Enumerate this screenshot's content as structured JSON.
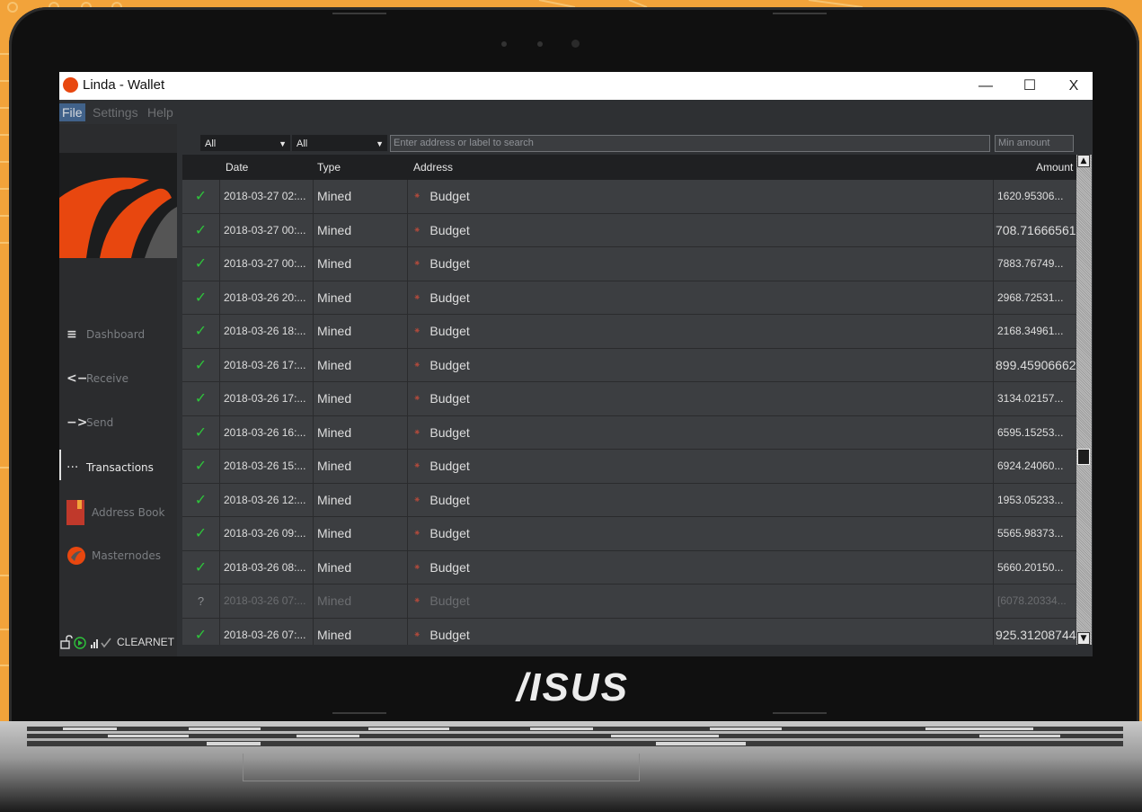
{
  "window": {
    "title": "Linda - Wallet",
    "minimize": "—",
    "maximize": "☐",
    "close": "X"
  },
  "menu": [
    "File",
    "Settings",
    "Help"
  ],
  "sidebar": {
    "items": [
      {
        "label": "Dashboard",
        "icon": "≡"
      },
      {
        "label": "Receive",
        "icon": "<−"
      },
      {
        "label": "Send",
        "icon": "−>"
      },
      {
        "label": "Transactions",
        "icon": "···"
      },
      {
        "label": "Address Book",
        "icon": "book-icon"
      },
      {
        "label": "Masternodes",
        "icon": "masternode-icon"
      }
    ],
    "status": {
      "network": "CLEARNET"
    }
  },
  "filters": {
    "date_filter": "All",
    "type_filter": "All",
    "search_placeholder": "Enter address or label to search",
    "min_amount_placeholder": "Min amount"
  },
  "table": {
    "columns": [
      "Date",
      "Type",
      "Address",
      "Amount"
    ],
    "rows": [
      {
        "status": "✓",
        "date": "2018-03-27 02:...",
        "type": "Mined",
        "address": "Budget",
        "amount": "1620.95306..."
      },
      {
        "status": "✓",
        "date": "2018-03-27 00:...",
        "type": "Mined",
        "address": "Budget",
        "amount": "708.71666561"
      },
      {
        "status": "✓",
        "date": "2018-03-27 00:...",
        "type": "Mined",
        "address": "Budget",
        "amount": "7883.76749..."
      },
      {
        "status": "✓",
        "date": "2018-03-26 20:...",
        "type": "Mined",
        "address": "Budget",
        "amount": "2968.72531..."
      },
      {
        "status": "✓",
        "date": "2018-03-26 18:...",
        "type": "Mined",
        "address": "Budget",
        "amount": "2168.34961..."
      },
      {
        "status": "✓",
        "date": "2018-03-26 17:...",
        "type": "Mined",
        "address": "Budget",
        "amount": "899.45906662"
      },
      {
        "status": "✓",
        "date": "2018-03-26 17:...",
        "type": "Mined",
        "address": "Budget",
        "amount": "3134.02157..."
      },
      {
        "status": "✓",
        "date": "2018-03-26 16:...",
        "type": "Mined",
        "address": "Budget",
        "amount": "6595.15253..."
      },
      {
        "status": "✓",
        "date": "2018-03-26 15:...",
        "type": "Mined",
        "address": "Budget",
        "amount": "6924.24060..."
      },
      {
        "status": "✓",
        "date": "2018-03-26 12:...",
        "type": "Mined",
        "address": "Budget",
        "amount": "1953.05233..."
      },
      {
        "status": "✓",
        "date": "2018-03-26 09:...",
        "type": "Mined",
        "address": "Budget",
        "amount": "5565.98373..."
      },
      {
        "status": "✓",
        "date": "2018-03-26 08:...",
        "type": "Mined",
        "address": "Budget",
        "amount": "5660.20150..."
      },
      {
        "status": "?",
        "date": "2018-03-26 07:...",
        "type": "Mined",
        "address": "Budget",
        "amount": "[6078.20334..."
      },
      {
        "status": "✓",
        "date": "2018-03-26 07:...",
        "type": "Mined",
        "address": "Budget",
        "amount": "925.31208744"
      }
    ]
  },
  "brand": {
    "laptop": "/ISUS",
    "accent": "#e8470f",
    "selected_menu": "#41628a",
    "confirmed": "#2ec43b"
  }
}
